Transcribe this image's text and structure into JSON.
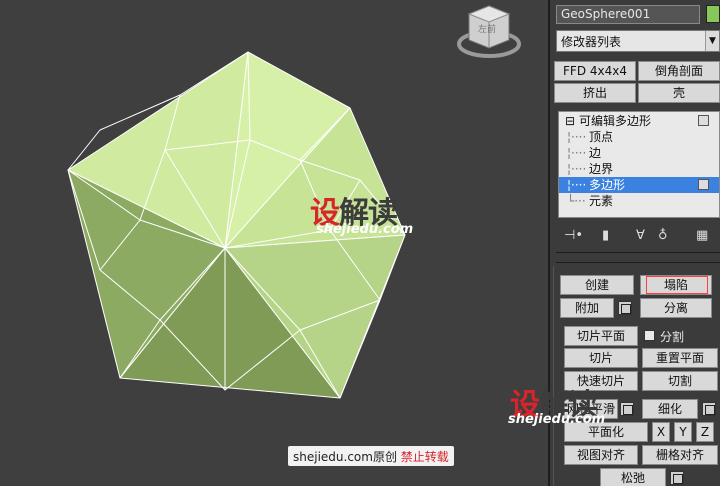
{
  "viewport": {
    "object_color": "#c9e89c",
    "viewcube_label": "左前"
  },
  "watermarks": {
    "logo_she": "设",
    "logo_rest": "解读",
    "url": "shejiedu.com",
    "copyright_prefix": "shejiedu.com原创",
    "copyright_warning": "禁止转载"
  },
  "panel": {
    "object_name": "GeoSphere001",
    "object_color": "#88c75a",
    "modifier_list": "修改器列表",
    "modifier_buttons": [
      "FFD 4x4x4",
      "倒角剖面",
      "挤出",
      "壳"
    ],
    "stack": {
      "root": "可编辑多边形",
      "items": [
        "顶点",
        "边",
        "边界",
        "多边形",
        "元素"
      ],
      "selected_index": 3
    },
    "stack_tools": [
      "pin-stack-icon",
      "show-end-result-icon",
      "make-unique-icon",
      "remove-modifier-icon",
      "configure-sets-icon"
    ],
    "edit_geometry": {
      "create": "创建",
      "collapse": "塌陷",
      "attach": "附加",
      "detach": "分离",
      "slice_plane": "切片平面",
      "split": "分割",
      "slice": "切片",
      "reset_plane": "重置平面",
      "quickslice": "快速切片",
      "cut": "切割",
      "msmooth": "网格平滑",
      "tessellate": "细化",
      "planar": "平面化",
      "x": "X",
      "y": "Y",
      "z": "Z",
      "view_align": "视图对齐",
      "grid_align": "栅格对齐",
      "relax": "松弛"
    }
  }
}
